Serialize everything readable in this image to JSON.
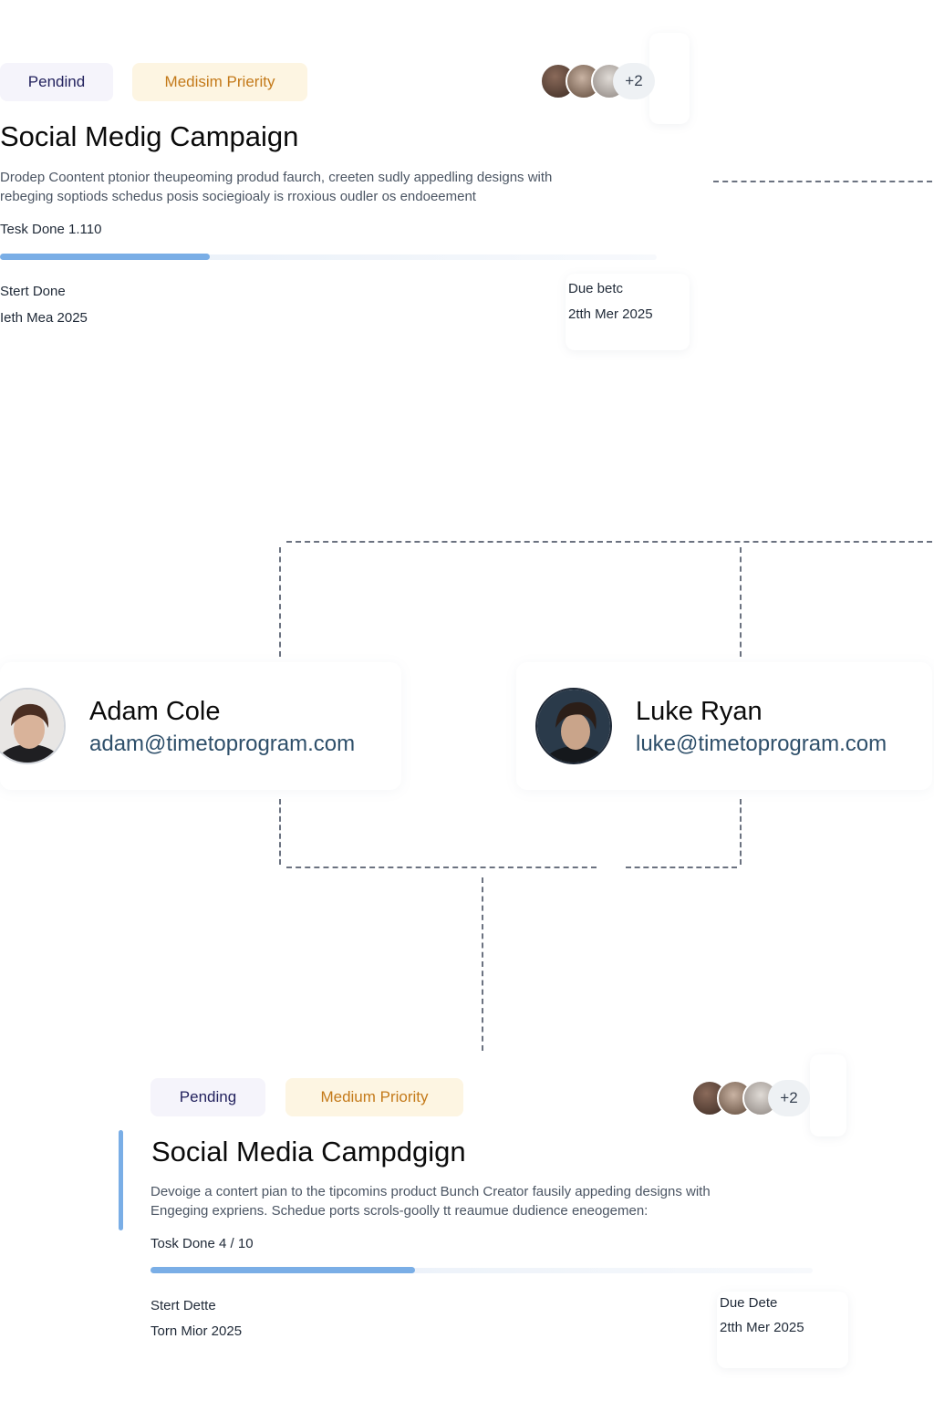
{
  "task_top": {
    "status": "Pendind",
    "priority": "Medisim Prierity",
    "assignees_more": "+2",
    "title": "Social Medig Campaign",
    "description_line1": "Drodep Coontent ptonior theupeoming produd faurch, creeten sudly appedling designs with",
    "description_line2": "rebeging soptiods schedus posis sociegioaly is rroxious oudler os endoeement",
    "tasks_label": "Tesk Done 1.110",
    "progress": 0.32,
    "start_label": "Stert Done",
    "start_value": "Ieth Mea 2025",
    "due_label": "Due betc",
    "due_value": "2tth Mer 2025"
  },
  "people": [
    {
      "name": "Adam Cole",
      "email": "adam@timetoprogram.com"
    },
    {
      "name": "Luke Ryan",
      "email": "luke@timetoprogram.com"
    }
  ],
  "task_bottom": {
    "status": "Pending",
    "priority": "Medium Priority",
    "assignees_more": "+2",
    "title": "Social Media Campdgign",
    "description_line1": "Devoige a contert pian to the tipcomins product Bunch Creator fausily appeding designs with",
    "description_line2": "Engeging expriens. Schedue ports scrols-goolly tt reaumue dudience eneogemen:",
    "tasks_label": "Tosk Done 4 / 10",
    "progress": 0.4,
    "start_label": "Stert Dette",
    "start_value": "Torn Mior 2025",
    "due_label": "Due Dete",
    "due_value": "2tth Mer 2025"
  },
  "colors": {
    "progress": "#7aaee6",
    "status_badge_bg": "#f5f4fb",
    "priority_badge_bg": "#fdf5e2",
    "priority_text": "#c47a1a",
    "connector": "#6b7280"
  }
}
